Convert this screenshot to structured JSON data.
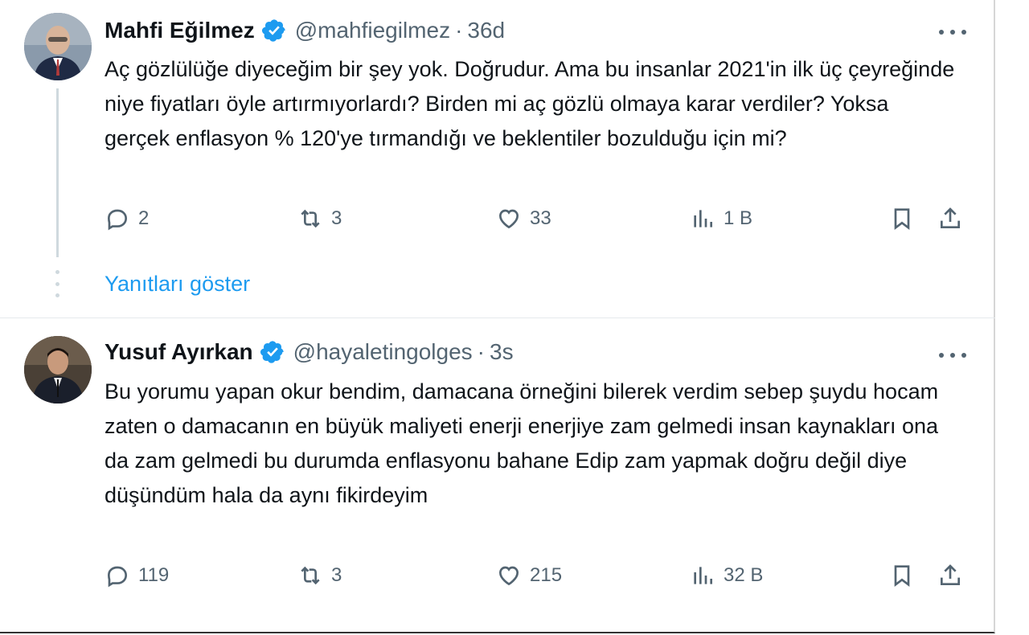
{
  "tweets": [
    {
      "name": "Mahfi Eğilmez",
      "handle": "@mahfiegilmez",
      "time": "36d",
      "text": "Aç gözlülüğe diyeceğim bir şey yok. Doğrudur. Ama bu insanlar 2021'in ilk üç çeyreğinde niye fiyatları öyle artırmıyorlardı? Birden mi aç gözlü olmaya karar verdiler? Yoksa gerçek enflasyon % 120'ye tırmandığı ve beklentiler bozulduğu için mi?",
      "replies": "2",
      "retweets": "3",
      "likes": "33",
      "views": "1 B"
    },
    {
      "name": "Yusuf Ayırkan",
      "handle": "@hayaletingolges",
      "time": "3s",
      "text": "Bu yorumu yapan okur bendim, damacana örneğini bilerek verdim sebep şuydu hocam zaten o damacanın en büyük maliyeti enerji enerjiye zam gelmedi insan kaynakları ona da zam gelmedi bu durumda enflasyonu bahane Edip zam yapmak doğru değil diye düşündüm hala da aynı fikirdeyim",
      "replies": "119",
      "retweets": "3",
      "likes": "215",
      "views": "32 B"
    }
  ],
  "show_replies_label": "Yanıtları göster",
  "separator": "·",
  "colors": {
    "accent": "#1d9bf0",
    "secondary_text": "#536471",
    "primary_text": "#0f1419"
  }
}
